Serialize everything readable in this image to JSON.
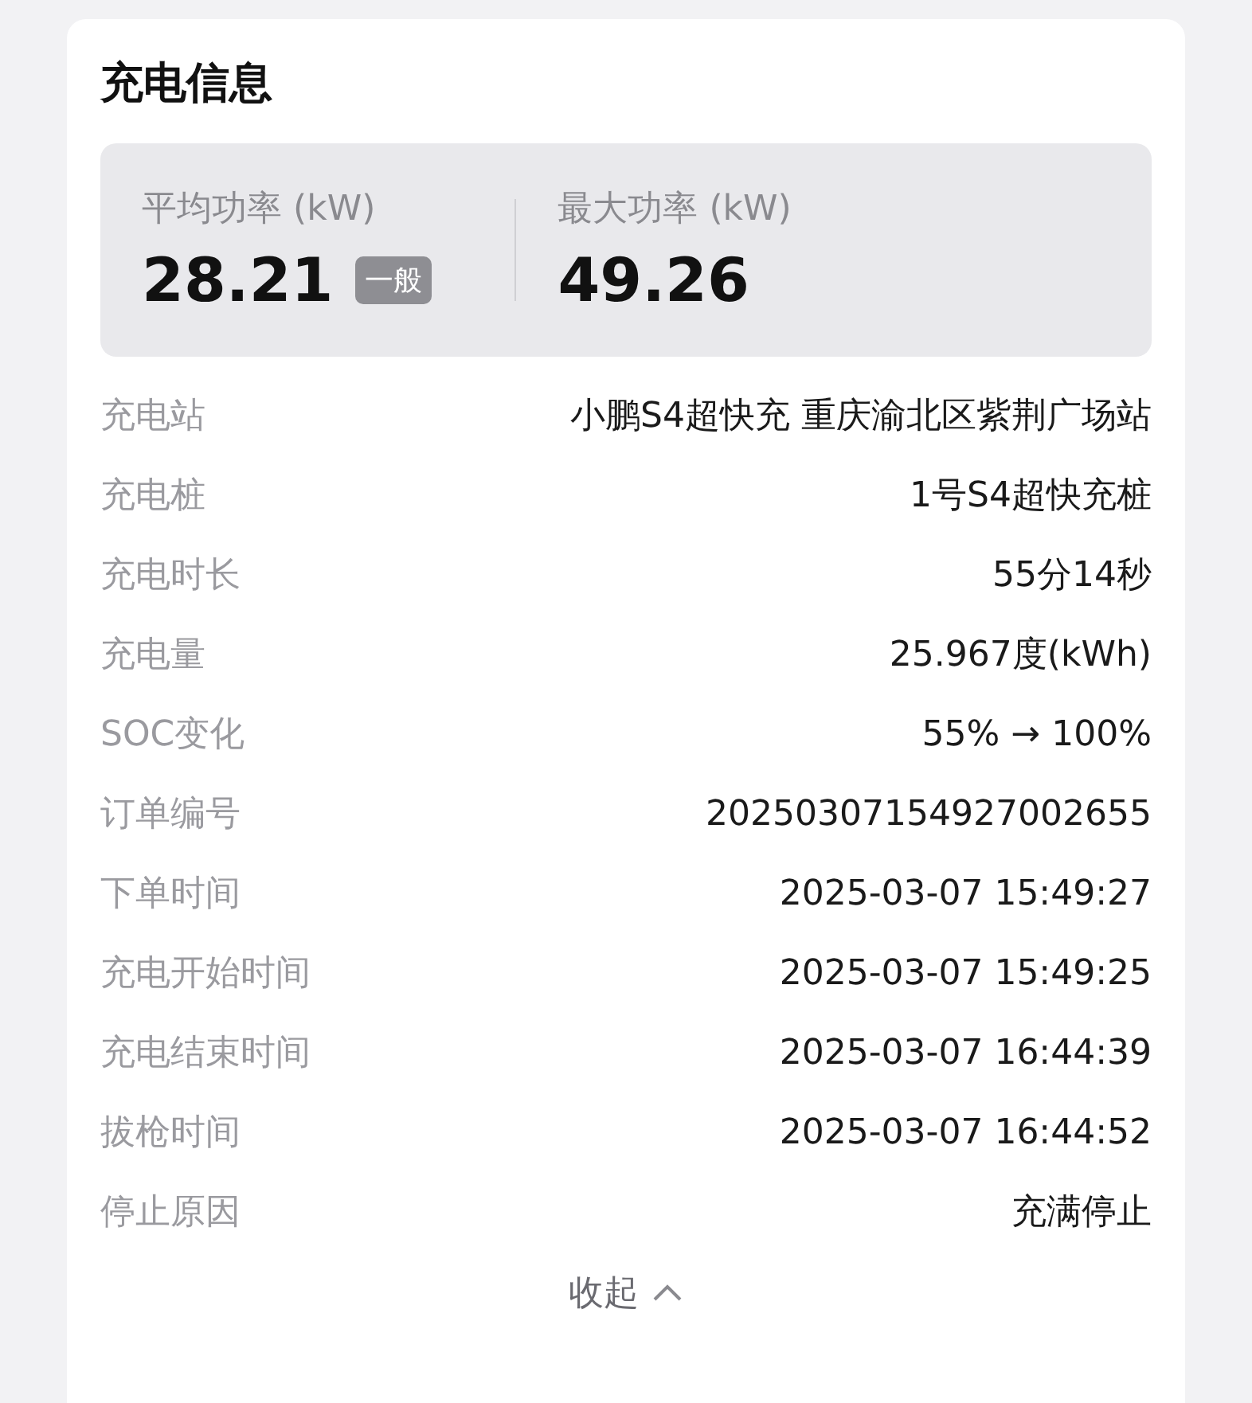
{
  "title": "充电信息",
  "summary": [
    {
      "label": "平均功率 (kW)",
      "value": "28.21",
      "badge": "一般"
    },
    {
      "label": "最大功率 (kW)",
      "value": "49.26"
    }
  ],
  "details": [
    {
      "label": "充电站",
      "value": "小鹏S4超快充 重庆渝北区紫荆广场站"
    },
    {
      "label": "充电桩",
      "value": "1号S4超快充桩"
    },
    {
      "label": "充电时长",
      "value": "55分14秒"
    },
    {
      "label": "充电量",
      "value": "25.967度(kWh)"
    },
    {
      "label": "SOC变化",
      "value": "55% → 100%"
    },
    {
      "label": "订单编号",
      "value": "20250307154927002655"
    },
    {
      "label": "下单时间",
      "value": "2025-03-07 15:49:27"
    },
    {
      "label": "充电开始时间",
      "value": "2025-03-07 15:49:25"
    },
    {
      "label": "充电结束时间",
      "value": "2025-03-07 16:44:39"
    },
    {
      "label": "拔枪时间",
      "value": "2025-03-07 16:44:52"
    },
    {
      "label": "停止原因",
      "value": "充满停止"
    }
  ],
  "collapse": {
    "label": "收起",
    "expanded": true
  }
}
